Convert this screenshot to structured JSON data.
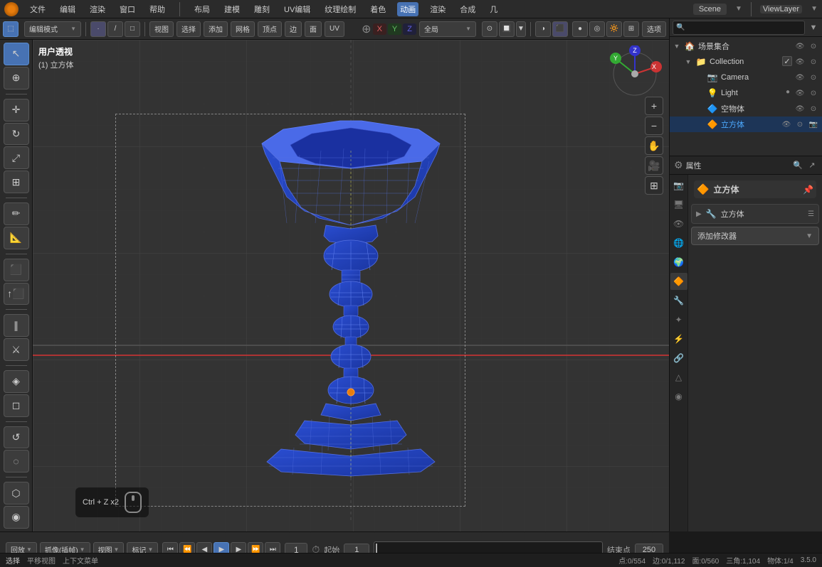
{
  "topbar": {
    "menus": [
      "文件",
      "编辑",
      "渲染",
      "窗口",
      "帮助",
      "布局",
      "建模",
      "雕刻",
      "UV编辑",
      "纹理绘制",
      "着色",
      "动画",
      "渲染",
      "合成",
      "几"
    ],
    "active_menu": "布局",
    "scene": "Scene",
    "viewlayer": "ViewLayer"
  },
  "second_toolbar": {
    "mode": "编辑模式",
    "view_label": "视图",
    "select_label": "选择",
    "add_label": "添加",
    "mesh_label": "网格",
    "vertex_label": "顶点",
    "edge_label": "边",
    "face_label": "面",
    "uv_label": "UV",
    "global_label": "全局",
    "select_label2": "选项"
  },
  "viewport": {
    "mode_label": "用户透视",
    "sub_label": "(1) 立方体",
    "coords": {
      "x": "X",
      "y": "Y",
      "z": "Z"
    },
    "options_btn": "选项"
  },
  "hint": {
    "shortcut": "Ctrl + Z x2"
  },
  "gizmo": {
    "x": "X",
    "y": "Y",
    "z": "Z"
  },
  "outliner": {
    "title": "场景集合",
    "search_placeholder": "",
    "items": [
      {
        "id": "collection",
        "label": "Collection",
        "depth": 1,
        "icon": "📁",
        "expanded": true
      },
      {
        "id": "camera",
        "label": "Camera",
        "depth": 2,
        "icon": "📷"
      },
      {
        "id": "light",
        "label": "Light",
        "depth": 2,
        "icon": "💡"
      },
      {
        "id": "empty",
        "label": "空物体",
        "depth": 2,
        "icon": "🔷"
      },
      {
        "id": "cube",
        "label": "立方体",
        "depth": 2,
        "icon": "🔶",
        "active": true
      }
    ]
  },
  "properties": {
    "object_name": "立方体",
    "modifier_btn": "添加修改器",
    "tabs": [
      "scene",
      "render",
      "output",
      "view",
      "object",
      "mesh",
      "material",
      "particles",
      "physics",
      "constraints",
      "data"
    ]
  },
  "timeline": {
    "playback_label": "回放",
    "interpolation_label": "抓像(插帧)",
    "view_label": "视图",
    "marker_label": "标记",
    "frame_current": "1",
    "start_label": "起始",
    "start_frame": "1",
    "end_label": "结束点",
    "end_frame": "250"
  },
  "statusbar": {
    "mode": "选择",
    "transform": "平移视图",
    "context_menu": "上下文菜单",
    "vertex_info": "点:0/554",
    "edge_info": "边:0/1,112",
    "face_info": "面:0/560",
    "tri_info": "三角:1,104",
    "object_info": "物体:1/4",
    "version": "3.5.0"
  }
}
